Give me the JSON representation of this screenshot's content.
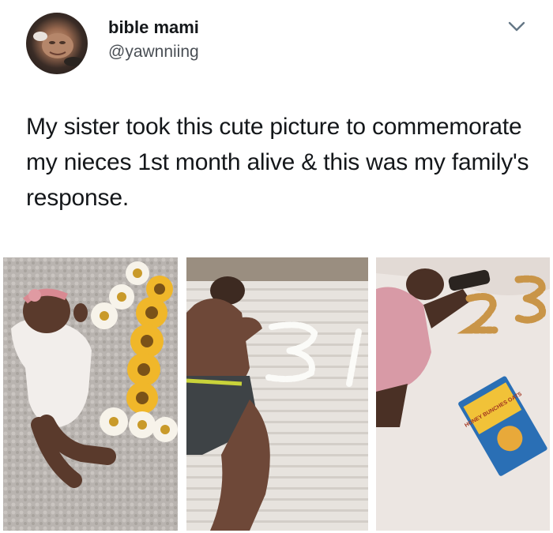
{
  "tweet": {
    "author": {
      "display_name": "bible mami",
      "handle": "@yawnniing"
    },
    "text": "My sister took this cute picture to commemorate my nieces 1st month alive & this was my family's response.",
    "icons": {
      "menu": "chevron-down-icon"
    },
    "photos": [
      {
        "name": "baby-with-flower-number-photo"
      },
      {
        "name": "man-with-cotton-number-photo"
      },
      {
        "name": "woman-with-cereal-number-photo"
      }
    ],
    "photo_text": {
      "cereal_box": "HONEY BUNCHES OATS"
    },
    "colors": {
      "text": "#14171a",
      "secondary_text": "#4a4f55"
    }
  }
}
